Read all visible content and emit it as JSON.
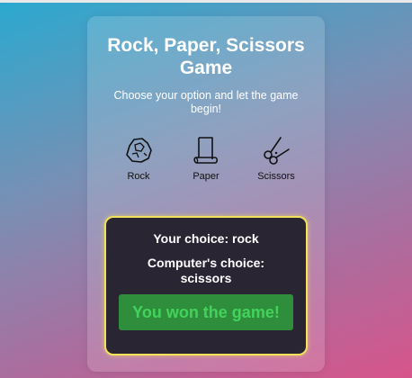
{
  "game": {
    "title": "Rock, Paper, Scissors Game",
    "subtitle": "Choose your option and let the game begin!"
  },
  "options": [
    {
      "label": "Rock",
      "icon": "rock-icon"
    },
    {
      "label": "Paper",
      "icon": "paper-scroll-icon"
    },
    {
      "label": "Scissors",
      "icon": "scissors-icon"
    }
  ],
  "result": {
    "your_choice_label": "Your choice:",
    "your_choice_value": "rock",
    "computer_choice_label": "Computer's choice:",
    "computer_choice_value": "scissors",
    "outcome": "You won the game!"
  },
  "colors": {
    "result_border": "#f2e15a",
    "outcome_bg": "#2f8e3c",
    "outcome_text": "#43d35c"
  }
}
